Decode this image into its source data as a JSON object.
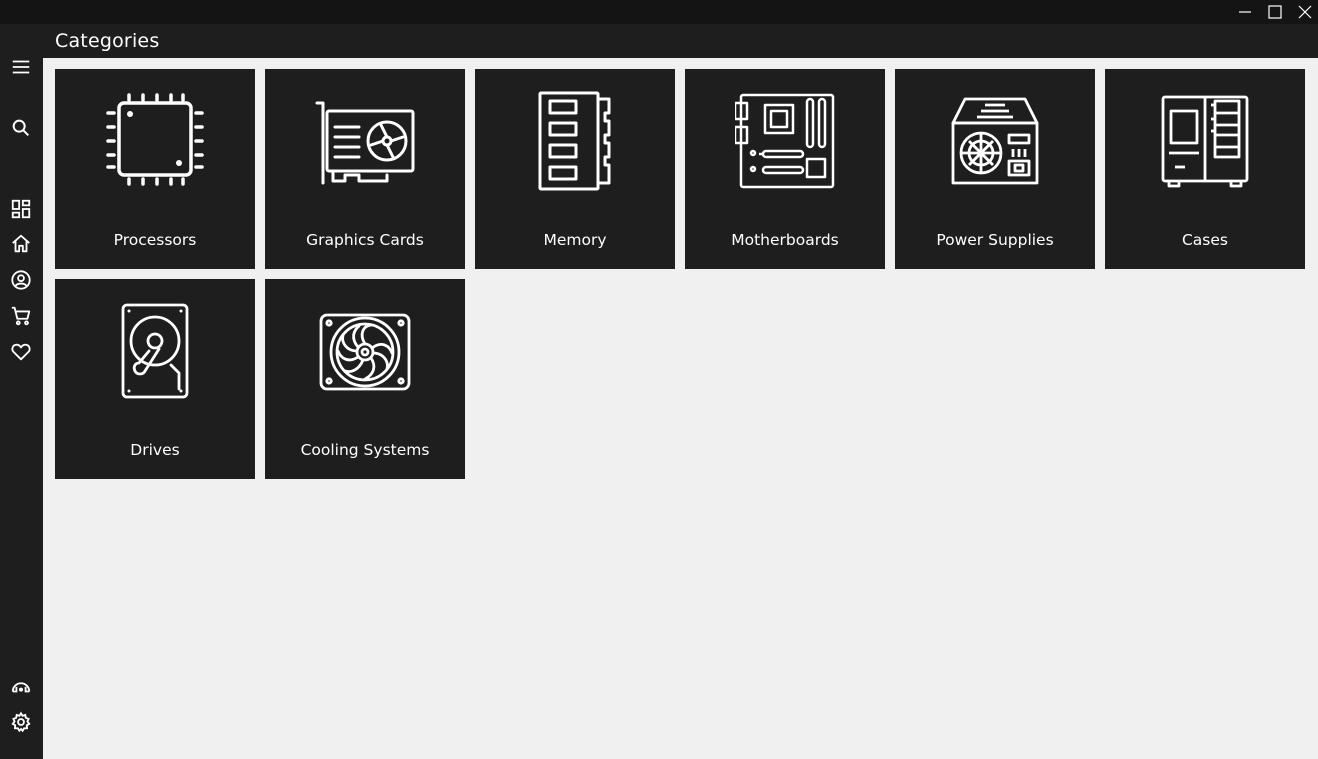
{
  "window": {
    "controls": [
      {
        "name": "minimize-icon"
      },
      {
        "name": "maximize-icon"
      },
      {
        "name": "close-icon"
      }
    ]
  },
  "header": {
    "title": "Categories"
  },
  "sidebar": {
    "top_items": [
      "hamburger-menu-icon",
      "search-icon",
      "dashboard-icon",
      "home-icon",
      "account-icon",
      "cart-icon",
      "heart-icon"
    ],
    "bottom_items": [
      "support-icon",
      "gear-icon"
    ]
  },
  "categories": [
    {
      "label": "Processors",
      "icon": "processor-icon"
    },
    {
      "label": "Graphics Cards",
      "icon": "graphics-card-icon"
    },
    {
      "label": "Memory",
      "icon": "memory-icon"
    },
    {
      "label": "Motherboards",
      "icon": "motherboard-icon"
    },
    {
      "label": "Power Supplies",
      "icon": "power-supply-icon"
    },
    {
      "label": "Cases",
      "icon": "case-icon"
    },
    {
      "label": "Drives",
      "icon": "drive-icon"
    },
    {
      "label": "Cooling Systems",
      "icon": "cooling-fan-icon"
    }
  ],
  "colors": {
    "background": "#f0f0f0",
    "panel": "#1e1e1e",
    "titlebar": "#141414",
    "foreground": "#ffffff"
  }
}
